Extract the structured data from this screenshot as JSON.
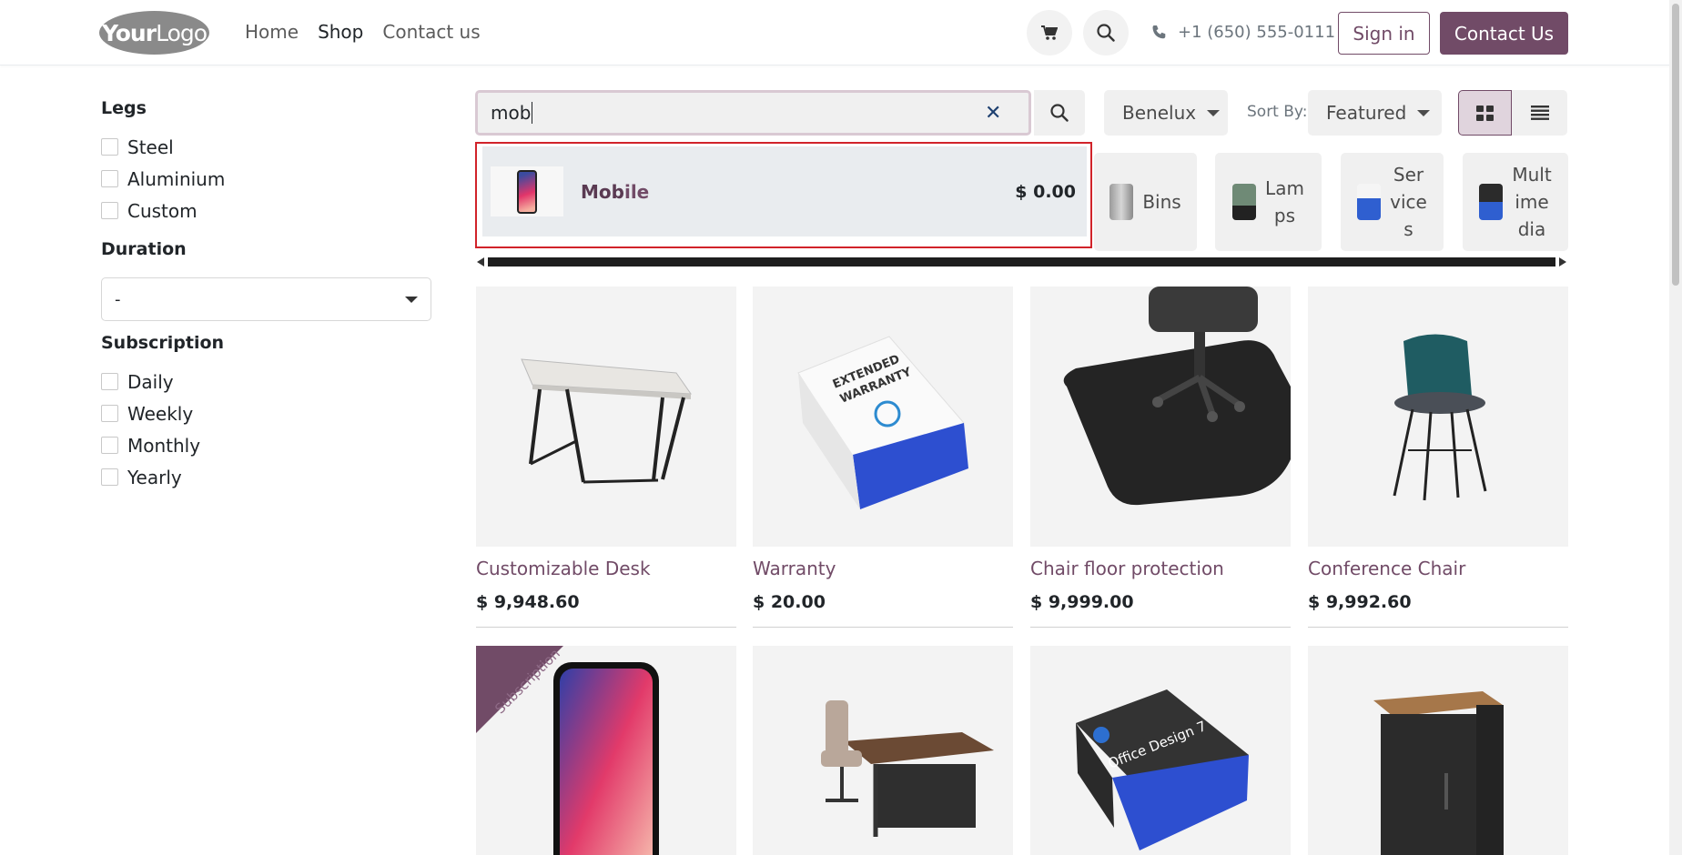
{
  "header": {
    "logo": {
      "part1": "Your",
      "part2": "Logo"
    },
    "nav": [
      {
        "label": "Home",
        "active": false
      },
      {
        "label": "Shop",
        "active": true
      },
      {
        "label": "Contact us",
        "active": false
      }
    ],
    "phone": "+1 (650) 555-0111",
    "sign_in": "Sign in",
    "contact_us": "Contact Us"
  },
  "sidebar": {
    "legs_title": "Legs",
    "legs": [
      "Steel",
      "Aluminium",
      "Custom"
    ],
    "duration_title": "Duration",
    "duration_value": "-",
    "subscription_title": "Subscription",
    "subscription": [
      "Daily",
      "Weekly",
      "Monthly",
      "Yearly"
    ]
  },
  "search": {
    "value": "mob"
  },
  "filters": {
    "pricelist": "Benelux",
    "sort_label": "Sort By:",
    "sort_value": "Featured"
  },
  "autocomplete": {
    "name_match": "Mob",
    "name_rest": "ile",
    "price": "$ 0.00"
  },
  "categories": [
    {
      "label": "Bins"
    },
    {
      "label_lines": [
        "Lam",
        "ps"
      ]
    },
    {
      "label_lines": [
        "Ser",
        "vice",
        "s"
      ]
    },
    {
      "label_lines": [
        "Mult",
        "ime",
        "dia"
      ]
    }
  ],
  "products": [
    {
      "name": "Customizable Desk",
      "price": "$ 9,948.60"
    },
    {
      "name": "Warranty",
      "price": "$ 20.00"
    },
    {
      "name": "Chair floor protection",
      "price": "$ 9,999.00"
    },
    {
      "name": "Conference Chair",
      "price": "$ 9,992.60"
    }
  ],
  "products_row2": [
    {
      "ribbon": "Subscription"
    },
    {},
    {
      "box_text": "Office Design 7"
    },
    {}
  ],
  "colors": {
    "brand": "#714b67",
    "highlight_border": "#d1232a"
  }
}
